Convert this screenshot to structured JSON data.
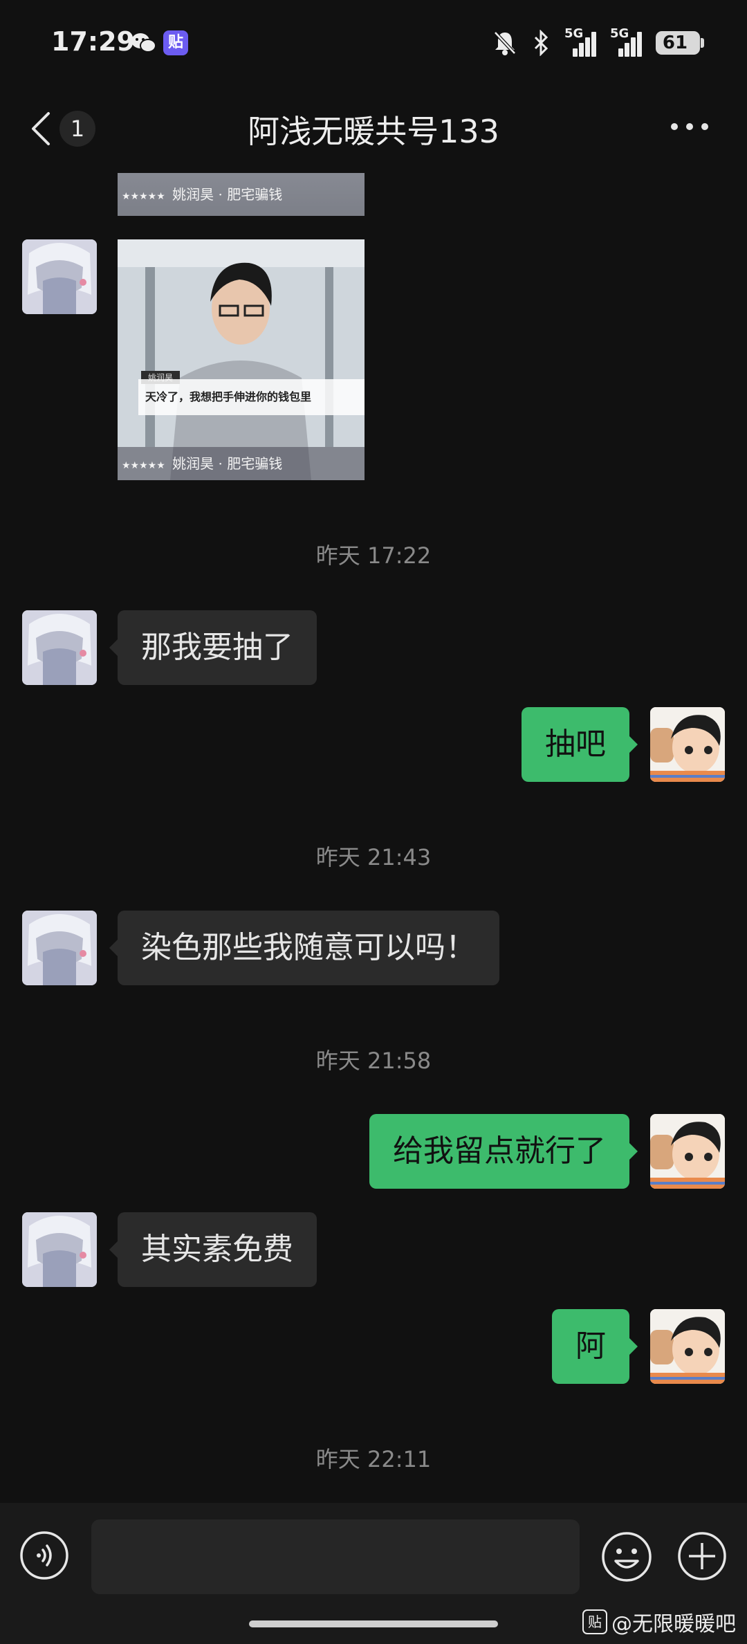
{
  "status_bar": {
    "time": "17:29",
    "tieba_badge": "贴",
    "signal_label_1": "5G",
    "signal_label_2": "5G",
    "battery": "61"
  },
  "header": {
    "unread_count": "1",
    "title": "阿浅无暖共号133"
  },
  "images": {
    "top_caption": "姚润昊 · 肥宅骗钱",
    "main_name_tag": "姚润昊",
    "main_overlay_text": "天冷了，我想把手伸进你的钱包里",
    "main_caption": "姚润昊 · 肥宅骗钱",
    "stars": "★★★★★"
  },
  "messages": [
    {
      "type": "timestamp",
      "text": "昨天 17:22"
    },
    {
      "type": "in",
      "text": "那我要抽了"
    },
    {
      "type": "out",
      "text": "抽吧"
    },
    {
      "type": "timestamp",
      "text": "昨天 21:43"
    },
    {
      "type": "in",
      "text": "染色那些我随意可以吗！"
    },
    {
      "type": "timestamp",
      "text": "昨天 21:58"
    },
    {
      "type": "out",
      "text": "给我留点就行了"
    },
    {
      "type": "in",
      "text": "其实素免费"
    },
    {
      "type": "out",
      "text": "阿"
    },
    {
      "type": "timestamp",
      "text": "昨天 22:11"
    }
  ],
  "input": {
    "value": "",
    "placeholder": ""
  },
  "watermark": {
    "icon_text": "贴",
    "text": "@无限暖暖吧"
  },
  "colors": {
    "background": "#111111",
    "incoming_bubble": "#2b2b2b",
    "outgoing_bubble": "#3dbb6c"
  },
  "icons": [
    "back-chevron-icon",
    "more-dots-icon",
    "voice-icon",
    "emoji-icon",
    "plus-icon",
    "mute-bell-icon",
    "bluetooth-icon",
    "wechat-icon"
  ]
}
